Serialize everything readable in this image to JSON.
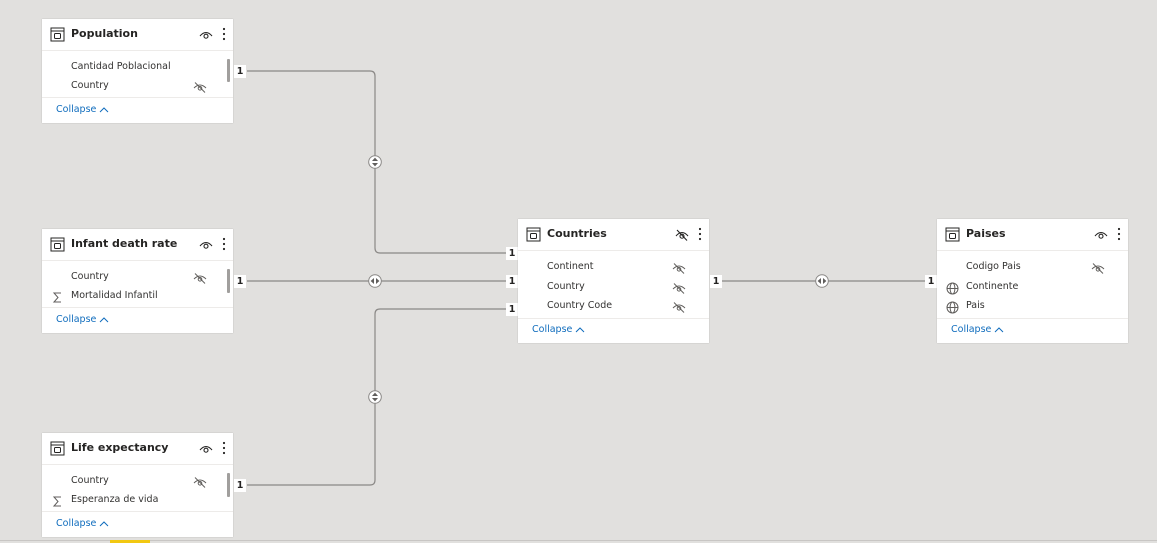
{
  "tables": {
    "population": {
      "title": "Population",
      "fields": [
        "Cantidad Poblacional",
        "Country"
      ],
      "collapse_label": "Collapse"
    },
    "infant": {
      "title": "Infant death rate",
      "fields": [
        "Country",
        "Mortalidad Infantil"
      ],
      "collapse_label": "Collapse"
    },
    "life": {
      "title": "Life expectancy",
      "fields": [
        "Country",
        "Esperanza de vida"
      ],
      "collapse_label": "Collapse"
    },
    "countries": {
      "title": "Countries",
      "fields": [
        "Continent",
        "Country",
        "Country Code"
      ],
      "collapse_label": "Collapse"
    },
    "paises": {
      "title": "Paises",
      "fields": [
        "Codigo Pais",
        "Continente",
        "Pais"
      ],
      "collapse_label": "Collapse"
    }
  },
  "cardinality": {
    "one": "1"
  },
  "colors": {
    "canvas": "#e1e0de",
    "card": "#ffffff",
    "link": "#0f6cbd",
    "line": "#8a8886"
  }
}
